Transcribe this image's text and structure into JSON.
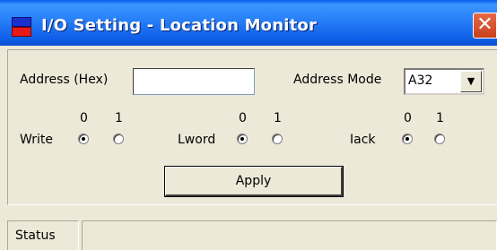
{
  "window": {
    "title": "I/O Setting - Location Monitor",
    "close_glyph": "✕",
    "titlebar_color": "#0A5CF0",
    "close_color": "#D4502C"
  },
  "form": {
    "address_label": "Address (Hex)",
    "address_value": "",
    "address_mode_label": "Address Mode",
    "address_mode_value": "A32",
    "dropdown_glyph": "▼",
    "radio_groups": [
      {
        "label": "Write",
        "options": [
          "0",
          "1"
        ],
        "selected": "0"
      },
      {
        "label": "Lword",
        "options": [
          "0",
          "1"
        ],
        "selected": "0"
      },
      {
        "label": "Iack",
        "options": [
          "0",
          "1"
        ],
        "selected": "0"
      }
    ],
    "apply_label": "Apply"
  },
  "statusbar": {
    "label": "Status",
    "message": ""
  }
}
